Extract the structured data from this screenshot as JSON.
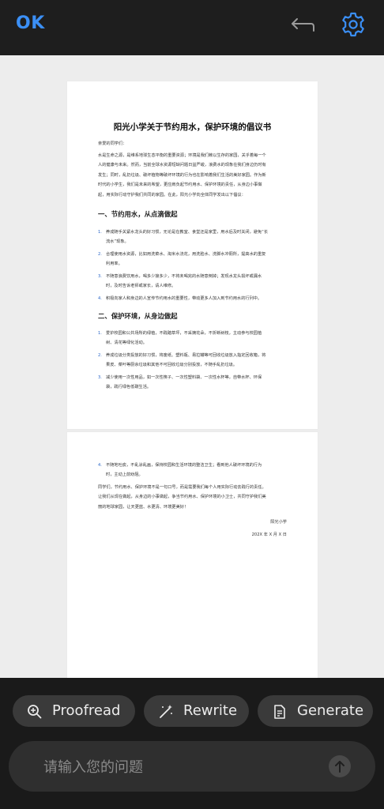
{
  "toolbar": {
    "ok_label": "OK",
    "accent_color": "#3b8ff5"
  },
  "document": {
    "title": "阳光小学关于节约用水，保护环境的倡议书",
    "greeting": "亲爱的同学们：",
    "intro_lines": [
      "水是生命之源，是维系地球生态平衡的重要资源；环境是我们赖以生存的家园，关乎着每一个",
      "人的健康与未来。然而，当前全球水资源短缺问题日益严峻，浪费水的现象在我们身边仍时有",
      "发生；同时，乱扔垃圾、破坏植物等破坏环境的行为也在影响着我们生活的美好家园。作为新",
      "时代的小学生，我们是未来的希望，更应肩负起节约用水、保护环境的责任，从身边小事做",
      "起，用实际行动守护我们共同的家园。在此，阳光小学向全体同学发出以下倡议："
    ],
    "section1_heading": "一、节约用水，从点滴做起",
    "section1_items": [
      {
        "num": "1.",
        "lines": [
          "养成随手关紧水龙头的好习惯，无论是在教室、食堂还是家里，用水后及时关闭，避免“长",
          "流水”现象。"
        ]
      },
      {
        "num": "2.",
        "lines": [
          "合理使用水资源，比如用洗菜水、淘米水浇花，用洗脸水、洗脚水冲厕所，提高水的重复",
          "利用率。"
        ]
      },
      {
        "num": "3.",
        "lines": [
          "不随意浪费饮用水，喝多少接多少，不将未喝完的水随意倒掉；发现水龙头损坏或漏水",
          "时，及时告诉老师或家长，请人维修。"
        ]
      },
      {
        "num": "4.",
        "lines": [
          "积极向家人和身边的人宣传节约用水的重要性，带动更多人加入到节约用水的行列中。"
        ]
      }
    ],
    "section2_heading": "二、保护环境，从身边做起",
    "section2_items": [
      {
        "num": "1.",
        "lines": [
          "爱护校园和公共场所的绿植，不践踏草坪，不采摘花朵，不折断树枝，主动参与校园植",
          "树、清花等绿化活动。"
        ]
      },
      {
        "num": "2.",
        "lines": [
          "养成垃圾分类投放的好习惯，将废纸、塑料瓶、易拉罐等可回收垃圾放入指定回收箱，将",
          "果皮、菜叶等厨余垃圾和其他不可回收垃圾分别投放，不随手乱扔垃圾。"
        ]
      },
      {
        "num": "3.",
        "lines": [
          "减少使用一次性用品，如一次性筷子、一次性塑料袋、一次性水杯等，自带水杯、环保",
          "袋，践行绿色低碳生活。"
        ]
      }
    ],
    "page2_item": {
      "num": "4.",
      "lines": [
        "不随地吐痰，不乱涂乱画，保持校园和生活环境的整洁卫生；看到他人破坏环境的行为",
        "时，主动上前劝阻。"
      ]
    },
    "closing_lines": [
      "同学们，节约用水、保护环境不是一句口号，而是需要我们每个人用实际行动去践行的责任。",
      "让我们从现在做起，从身边的小事做起，争当节约用水、保护环境的小卫士，共同守护我们美",
      "丽的地球家园，让天更蓝、水更清、环境更美好！"
    ],
    "signature": "阳光小学",
    "date": "202X 年 X 月 X 日"
  },
  "actions": {
    "proofread": "Proofread",
    "rewrite": "Rewrite",
    "generate": "Generate"
  },
  "ask": {
    "placeholder": "请输入您的问题"
  }
}
